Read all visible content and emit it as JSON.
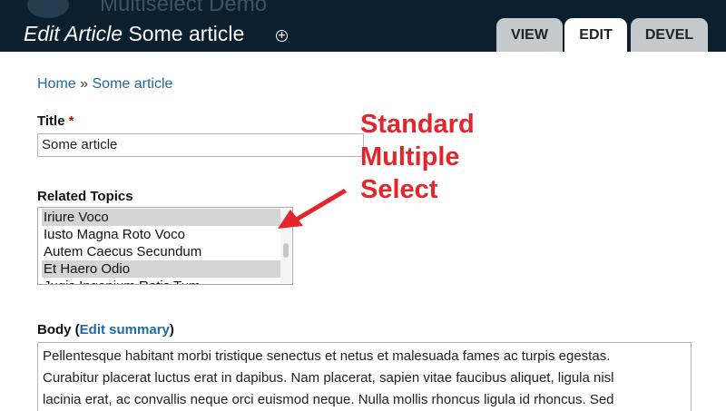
{
  "header": {
    "site_name": "Multiselect Demo",
    "title_prefix": "Edit Article",
    "title_suffix": "Some article",
    "shortcut_symbol": "+",
    "tabs": [
      {
        "label": "VIEW",
        "active": false
      },
      {
        "label": "EDIT",
        "active": true
      },
      {
        "label": "DEVEL",
        "active": false
      }
    ]
  },
  "breadcrumb": {
    "home": "Home",
    "separator": "»",
    "current": "Some article"
  },
  "form": {
    "title_label": "Title",
    "required_mark": "*",
    "title_value": "Some article",
    "topics_label": "Related Topics",
    "topics_options": [
      {
        "label": "Iriure Voco",
        "selected": true
      },
      {
        "label": "Iusto Magna Roto Voco",
        "selected": false
      },
      {
        "label": "Autem Caecus Secundum",
        "selected": false
      },
      {
        "label": "Et Haero Odio",
        "selected": true
      },
      {
        "label": "Jugis Ingenium Ratis Tum",
        "selected": false
      }
    ],
    "body_label": "Body",
    "body_paren_open": "(",
    "edit_summary_link": "Edit summary",
    "body_paren_close": ")",
    "body_lines": [
      "Pellentesque habitant morbi tristique senectus et netus et malesuada fames ac turpis egestas.",
      "Curabitur placerat luctus erat in dapibus. Nam placerat, sapien vitae faucibus aliquet, ligula nisl",
      "lacinia erat, ac convallis neque orci euismod neque. Nulla mollis rhoncus ligula id rhoncus. Sed"
    ]
  },
  "annotation": {
    "lines": [
      "Standard",
      "Multiple",
      "Select"
    ],
    "color": "#e2262c"
  },
  "colors": {
    "header_bg": "#0c1f2f",
    "link": "#1d6aa2",
    "tab_inactive": "#c5c9cb"
  }
}
